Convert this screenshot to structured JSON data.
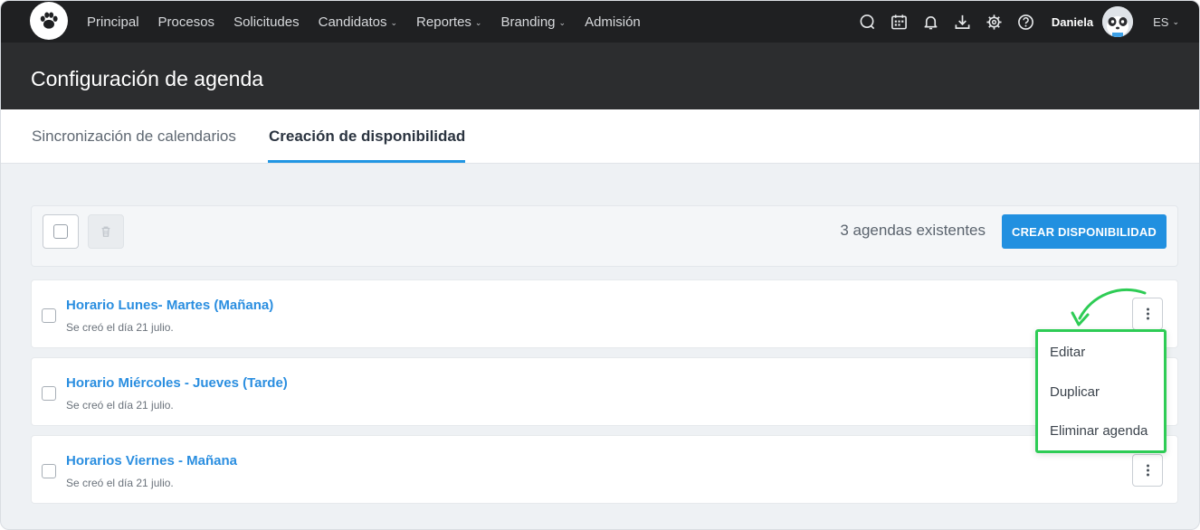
{
  "nav": {
    "links": [
      "Principal",
      "Procesos",
      "Solicitudes",
      "Candidatos",
      "Reportes",
      "Branding",
      "Admisión"
    ],
    "dropdown_links": [
      "Candidatos",
      "Reportes",
      "Branding"
    ],
    "icons": [
      "chat-icon",
      "calendar-icon",
      "bell-icon",
      "download-icon",
      "gear-icon",
      "help-icon"
    ],
    "username": "Daniela",
    "language": "ES"
  },
  "header": {
    "title": "Configuración de agenda"
  },
  "tabs": [
    {
      "label": "Sincronización de calendarios",
      "active": false
    },
    {
      "label": "Creación de disponibilidad",
      "active": true
    }
  ],
  "toolbar": {
    "count_text": "3 agendas existentes",
    "create_label": "CREAR DISPONIBILIDAD"
  },
  "agendas": [
    {
      "title": "Horario Lunes- Martes (Mañana)",
      "created": "Se creó el día 21 julio."
    },
    {
      "title": "Horario Miércoles - Jueves (Tarde)",
      "created": "Se creó el día 21 julio."
    },
    {
      "title": "Horarios Viernes - Mañana",
      "created": "Se creó el día 21 julio."
    }
  ],
  "menu": {
    "items": [
      "Editar",
      "Duplicar",
      "Eliminar agenda"
    ],
    "highlight_color": "#2ecc55"
  },
  "colors": {
    "accent": "#2190e0",
    "link": "#2a8ee0",
    "nav_bg": "#1f2022",
    "header_bg": "#2c2d2f"
  }
}
